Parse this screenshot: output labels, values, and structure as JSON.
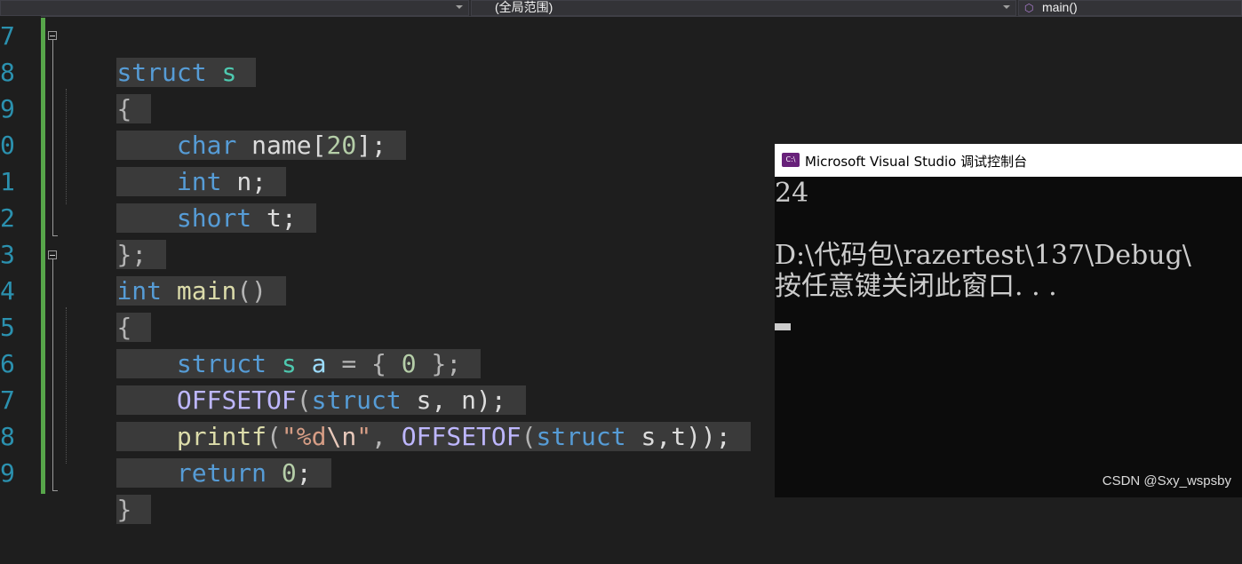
{
  "toolbar": {
    "scope_combo": "(全局范围)",
    "member_combo": "main()",
    "member_icon": "cube-icon"
  },
  "editor": {
    "line_numbers": [
      "7",
      "8",
      "9",
      "0",
      "1",
      "2",
      "3",
      "4",
      "5",
      "6",
      "7",
      "8",
      "9"
    ],
    "lines": {
      "l7": {
        "kw": "struct",
        "name": "s"
      },
      "l8": {
        "brace": "{"
      },
      "l9": {
        "type": "char",
        "rest": "name[",
        "num": "20",
        "end": "];"
      },
      "l10": {
        "type": "int",
        "rest": "n;"
      },
      "l11": {
        "type": "short",
        "rest": "t;"
      },
      "l12": {
        "brace": "};"
      },
      "l13": {
        "type": "int",
        "fn": "main",
        "paren": "()"
      },
      "l14": {
        "brace": "{"
      },
      "l15": {
        "kw": "struct",
        "sname": "s",
        "var": "a",
        "eq": "=",
        "open": "{",
        "num": "0",
        "close": "};"
      },
      "l16": {
        "macro": "OFFSETOF",
        "open": "(",
        "kw": "struct",
        "rest": "s, n);"
      },
      "l17": {
        "fn": "printf",
        "open": "(",
        "q": "\"",
        "fmt": "%d",
        "esc": "\\n",
        "q2": "\"",
        "comma": ",",
        "macro": "OFFSETOF",
        "open2": "(",
        "kw": "struct",
        "rest": "s,t));"
      },
      "l18": {
        "kw": "return",
        "num": "0",
        "semi": ";"
      },
      "l19": {
        "brace": "}"
      }
    }
  },
  "console": {
    "title": "Microsoft Visual Studio 调试控制台",
    "icon_text": "C:\\",
    "output": [
      "24",
      "",
      "D:\\代码包\\razertest\\137\\Debug\\",
      "按任意键关闭此窗口. . ."
    ]
  },
  "watermark": "CSDN @Sxy_wspsby"
}
